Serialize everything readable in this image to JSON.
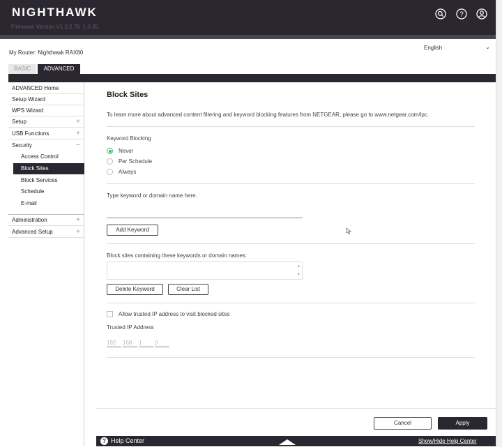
{
  "header": {
    "logo": "NIGHTHAWK",
    "firmware_label": "Firmware Version V1.0.2.76",
    "firmware_sub": "1.0.35",
    "icons": [
      "search-icon",
      "help-icon",
      "user-icon"
    ]
  },
  "router": {
    "label": "My Router: Nighthawk RAX80"
  },
  "language": {
    "selected": "English"
  },
  "tabs": [
    {
      "label": "BASIC",
      "active": false
    },
    {
      "label": "ADVANCED",
      "active": true
    }
  ],
  "sidebar": {
    "items": [
      {
        "label": "ADVANCED Home"
      },
      {
        "label": "Setup Wizard"
      },
      {
        "label": "WPS Wizard"
      },
      {
        "label": "Setup",
        "toggle": "+"
      },
      {
        "label": "USB Functions",
        "toggle": "+"
      },
      {
        "label": "Security",
        "toggle": "−"
      },
      {
        "label": "Administration",
        "toggle": "+"
      },
      {
        "label": "Advanced Setup",
        "toggle": "+"
      }
    ],
    "security_sub": [
      {
        "label": "Access Control"
      },
      {
        "label": "Block Sites",
        "active": true
      },
      {
        "label": "Block Services"
      },
      {
        "label": "Schedule"
      },
      {
        "label": "E-mail"
      }
    ]
  },
  "main": {
    "title": "Block Sites",
    "intro": "To learn more about advanced content filtering and keyword blocking features from NETGEAR, please go to www.netgear.com/lpc.",
    "keyword_blocking": {
      "label": "Keyword Blocking",
      "options": [
        "Never",
        "Per Schedule",
        "Always"
      ],
      "selected": "Never"
    },
    "keyword_input": {
      "label": "Type keyword or domain name here.",
      "value": ""
    },
    "add_keyword_label": "Add Keyword",
    "list_label": "Block sites containing these keywords or domain names:",
    "delete_keyword_label": "Delete Keyword",
    "clear_list_label": "Clear List",
    "allow_trusted_label": "Allow trusted IP address to visit blocked sites",
    "trusted_ip": {
      "label": "Trusted IP Address",
      "octets": [
        "192",
        "168",
        "1",
        "0"
      ]
    },
    "cancel_label": "Cancel",
    "apply_label": "Apply"
  },
  "help": {
    "label": "Help Center",
    "toggle_label": "Show/Hide Help Center"
  },
  "colors": {
    "dark": "#2b2730",
    "accent_green": "#3aba6b"
  }
}
